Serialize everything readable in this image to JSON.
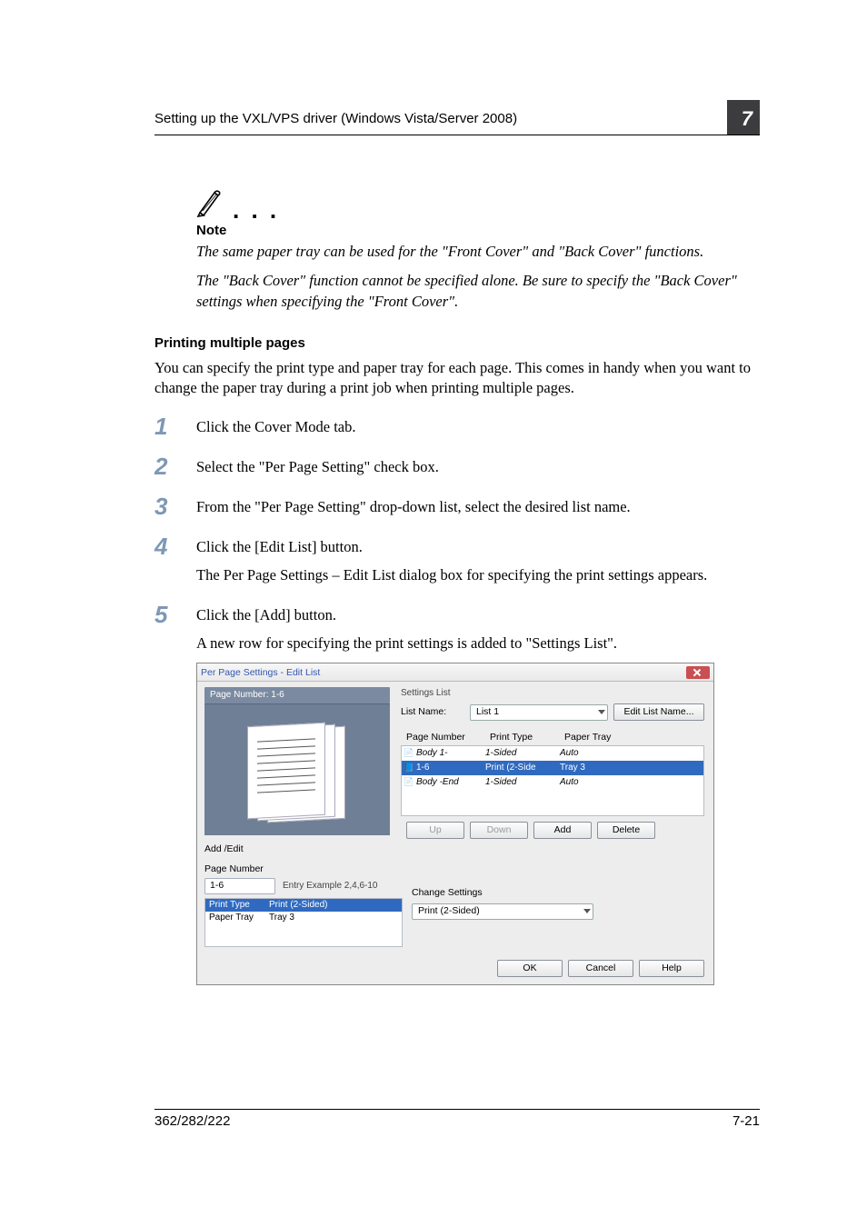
{
  "header": {
    "section": "Setting up the VXL/VPS driver (Windows Vista/Server 2008)",
    "chapter": "7"
  },
  "note": {
    "label": "Note",
    "p1": "The same paper tray can be used for the \"Front Cover\" and \"Back Cover\" functions.",
    "p2": "The \"Back Cover\" function cannot be specified alone. Be sure to specify the \"Back Cover\" settings when specifying the \"Front Cover\"."
  },
  "section": {
    "heading": "Printing multiple pages",
    "body": "You can specify the print type and paper tray for each page. This comes in handy when you want to change the paper tray during a print job when printing multiple pages."
  },
  "steps": {
    "s1": "Click the Cover Mode tab.",
    "s2": "Select the \"Per Page Setting\" check box.",
    "s3": "From the \"Per Page Setting\" drop-down list, select the desired list name.",
    "s4": "Click the [Edit List] button.",
    "s4sub": "The Per Page Settings – Edit List dialog box for specifying the print settings appears.",
    "s5": "Click the [Add] button.",
    "s5sub": "A new row for specifying the print settings is added to \"Settings List\"."
  },
  "dialog": {
    "title": "Per Page Settings - Edit List",
    "preview_label": "Page Number: 1-6",
    "settings_list_label": "Settings List",
    "list_name_label": "List Name:",
    "list_name_value": "List 1",
    "edit_list_name": "Edit List Name...",
    "cols": {
      "pn": "Page Number",
      "pt": "Print Type",
      "tr": "Paper Tray"
    },
    "rows": [
      {
        "icon": "📄",
        "pn": "Body 1-",
        "pt": "1-Sided",
        "tr": "Auto",
        "sel": false
      },
      {
        "icon": "",
        "pn": "1-6",
        "pt": "Print (2-Side",
        "tr": "Tray 3",
        "sel": true
      },
      {
        "icon": "📄",
        "pn": "Body   -End",
        "pt": "1-Sided",
        "tr": "Auto",
        "sel": false
      }
    ],
    "btns": {
      "up": "Up",
      "down": "Down",
      "add": "Add",
      "del": "Delete"
    },
    "addedit_label": "Add /Edit",
    "page_number_label": "Page Number",
    "page_number_value": "1-6",
    "entry_example": "Entry Example 2,4,6-10",
    "sel_rows": [
      {
        "a": "Print Type",
        "b": "Print (2-Sided)",
        "sel": true
      },
      {
        "a": "Paper Tray",
        "b": "Tray 3",
        "sel": false
      }
    ],
    "change_settings_label": "Change Settings",
    "change_settings_value": "Print (2-Sided)",
    "ok": "OK",
    "cancel": "Cancel",
    "help": "Help"
  },
  "footer": {
    "left": "362/282/222",
    "right": "7-21"
  }
}
